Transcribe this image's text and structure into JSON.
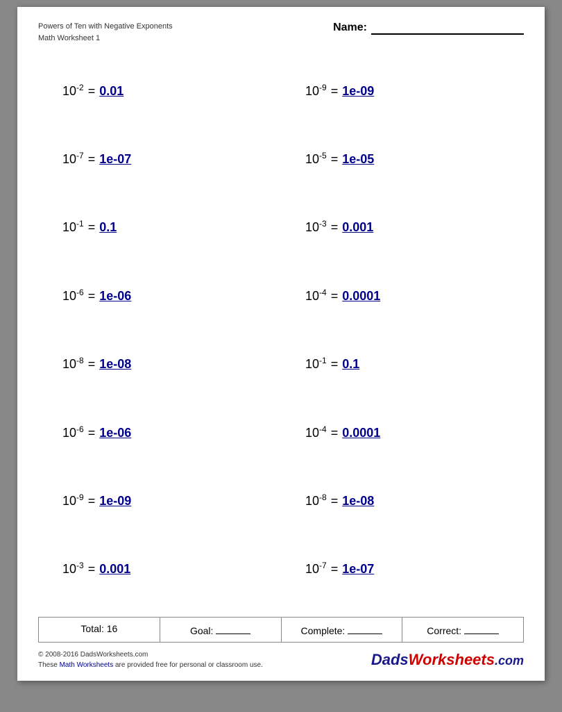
{
  "header": {
    "subtitle": "Powers of Ten with Negative Exponents",
    "title": "Math Worksheet 1",
    "name_label": "Name:",
    "name_placeholder": ""
  },
  "problems": [
    [
      {
        "base": "10",
        "exp": "-2",
        "equals": "=",
        "answer": "0.01"
      },
      {
        "base": "10",
        "exp": "-9",
        "equals": "=",
        "answer": "1e-09"
      }
    ],
    [
      {
        "base": "10",
        "exp": "-7",
        "equals": "=",
        "answer": "1e-07"
      },
      {
        "base": "10",
        "exp": "-5",
        "equals": "=",
        "answer": "1e-05"
      }
    ],
    [
      {
        "base": "10",
        "exp": "-1",
        "equals": "=",
        "answer": "0.1"
      },
      {
        "base": "10",
        "exp": "-3",
        "equals": "=",
        "answer": "0.001"
      }
    ],
    [
      {
        "base": "10",
        "exp": "-6",
        "equals": "=",
        "answer": "1e-06"
      },
      {
        "base": "10",
        "exp": "-4",
        "equals": "=",
        "answer": "0.0001"
      }
    ],
    [
      {
        "base": "10",
        "exp": "-8",
        "equals": "=",
        "answer": "1e-08"
      },
      {
        "base": "10",
        "exp": "-1",
        "equals": "=",
        "answer": "0.1"
      }
    ],
    [
      {
        "base": "10",
        "exp": "-6",
        "equals": "=",
        "answer": "1e-06"
      },
      {
        "base": "10",
        "exp": "-4",
        "equals": "=",
        "answer": "0.0001"
      }
    ],
    [
      {
        "base": "10",
        "exp": "-9",
        "equals": "=",
        "answer": "1e-09"
      },
      {
        "base": "10",
        "exp": "-8",
        "equals": "=",
        "answer": "1e-08"
      }
    ],
    [
      {
        "base": "10",
        "exp": "-3",
        "equals": "=",
        "answer": "0.001"
      },
      {
        "base": "10",
        "exp": "-7",
        "equals": "=",
        "answer": "1e-07"
      }
    ]
  ],
  "footer": {
    "total_label": "Total: 16",
    "goal_label": "Goal:",
    "complete_label": "Complete:",
    "correct_label": "Correct:"
  },
  "copyright": {
    "line1": "© 2008-2016 DadsWorksheets.com",
    "line2_pre": "These ",
    "line2_link": "Math Worksheets",
    "line2_post": " are provided free for personal or classroom use.",
    "logo_dads": "Dads",
    "logo_worksheets": "Worksheets",
    "logo_com": ".com"
  }
}
